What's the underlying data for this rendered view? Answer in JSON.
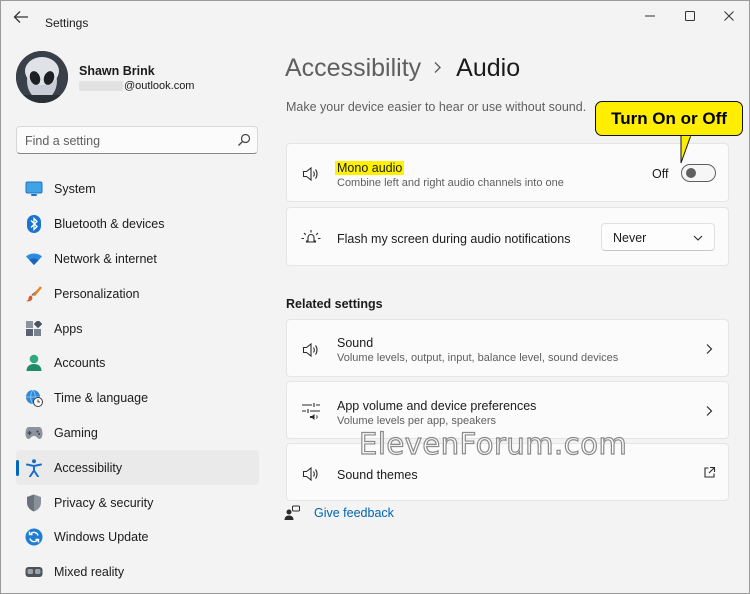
{
  "window": {
    "title": "Settings"
  },
  "profile": {
    "name": "Shawn Brink",
    "email_suffix": "@outlook.com"
  },
  "search": {
    "placeholder": "Find a setting"
  },
  "nav": {
    "items": [
      {
        "label": "System",
        "icon": "system-icon"
      },
      {
        "label": "Bluetooth & devices",
        "icon": "bluetooth-icon"
      },
      {
        "label": "Network & internet",
        "icon": "wifi-icon"
      },
      {
        "label": "Personalization",
        "icon": "brush-icon"
      },
      {
        "label": "Apps",
        "icon": "apps-icon"
      },
      {
        "label": "Accounts",
        "icon": "accounts-icon"
      },
      {
        "label": "Time & language",
        "icon": "globe-clock-icon"
      },
      {
        "label": "Gaming",
        "icon": "gamepad-icon"
      },
      {
        "label": "Accessibility",
        "icon": "accessibility-icon",
        "active": true
      },
      {
        "label": "Privacy & security",
        "icon": "shield-icon"
      },
      {
        "label": "Windows Update",
        "icon": "update-icon"
      },
      {
        "label": "Mixed reality",
        "icon": "vr-headset-icon"
      }
    ]
  },
  "main": {
    "breadcrumb_parent": "Accessibility",
    "breadcrumb_current": "Audio",
    "subtitle": "Make your device easier to hear or use without sound.",
    "mono_audio": {
      "title": "Mono audio",
      "description": "Combine left and right audio channels into one",
      "state_label": "Off",
      "enabled": false
    },
    "flash_screen": {
      "title": "Flash my screen during audio notifications",
      "selected": "Never"
    },
    "related_heading": "Related settings",
    "related": [
      {
        "title": "Sound",
        "description": "Volume levels, output, input, balance level, sound devices"
      },
      {
        "title": "App volume and device preferences",
        "description": "Volume levels per app, speakers"
      },
      {
        "title": "Sound themes",
        "description": ""
      }
    ],
    "feedback_label": "Give feedback"
  },
  "callout": {
    "text": "Turn On or Off"
  },
  "watermark": "ElevenForum.com",
  "colors": {
    "accent": "#0067c0",
    "highlight": "#fff200",
    "callout": "#ffee00",
    "link": "#0063b1"
  }
}
